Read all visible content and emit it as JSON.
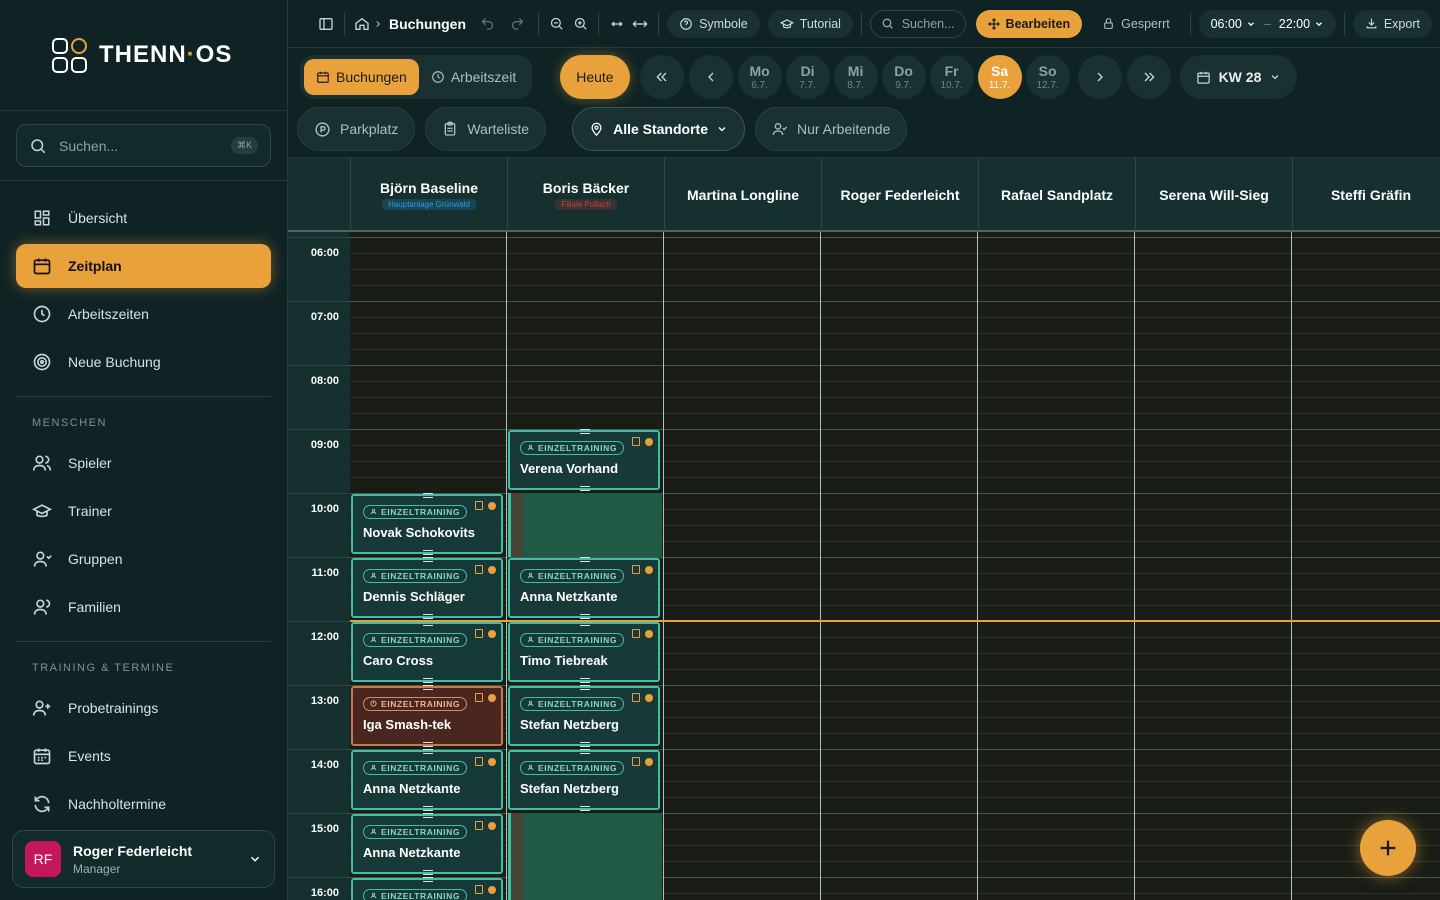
{
  "app": {
    "logo_main": "THENN",
    "logo_dot": "·",
    "logo_suffix": "OS"
  },
  "sidebar": {
    "search": {
      "placeholder": "Suchen...",
      "shortcut": "⌘K"
    },
    "items": [
      {
        "label": "Übersicht",
        "icon": "grid-icon"
      },
      {
        "label": "Zeitplan",
        "icon": "calendar-icon",
        "active": true
      },
      {
        "label": "Arbeitszeiten",
        "icon": "clock-icon"
      },
      {
        "label": "Neue Buchung",
        "icon": "target-icon"
      }
    ],
    "section_people": "MENSCHEN",
    "people_items": [
      {
        "label": "Spieler",
        "icon": "users-icon"
      },
      {
        "label": "Trainer",
        "icon": "graduation-cap-icon"
      },
      {
        "label": "Gruppen",
        "icon": "group-icon"
      },
      {
        "label": "Familien",
        "icon": "family-icon"
      }
    ],
    "section_training": "TRAINING & TERMINE",
    "training_items": [
      {
        "label": "Probetrainings",
        "icon": "user-plus-icon"
      },
      {
        "label": "Events",
        "icon": "calendar-grid-icon"
      },
      {
        "label": "Nachholtermine",
        "icon": "refresh-icon"
      }
    ],
    "user": {
      "initials": "RF",
      "name": "Roger Federleicht",
      "role": "Manager"
    }
  },
  "topbar": {
    "breadcrumb": "Buchungen",
    "symbols": "Symbole",
    "tutorial": "Tutorial",
    "search_placeholder": "Suchen...",
    "edit": "Bearbeiten",
    "locked": "Gesperrt",
    "time_from": "06:00",
    "time_sep": "–",
    "time_to": "22:00",
    "export": "Export"
  },
  "toolbar": {
    "tab_bookings": "Buchungen",
    "tab_worktime": "Arbeitszeit",
    "today": "Heute",
    "days": [
      {
        "name": "Mo",
        "date": "6.7."
      },
      {
        "name": "Di",
        "date": "7.7."
      },
      {
        "name": "Mi",
        "date": "8.7."
      },
      {
        "name": "Do",
        "date": "9.7."
      },
      {
        "name": "Fr",
        "date": "10.7."
      },
      {
        "name": "Sa",
        "date": "11.7.",
        "active": true
      },
      {
        "name": "So",
        "date": "12.7."
      }
    ],
    "week": "KW 28",
    "parking": "Parkplatz",
    "waitlist": "Warteliste",
    "locations": "Alle Standorte",
    "only_working": "Nur Arbeitende"
  },
  "calendar": {
    "trainers": [
      {
        "name": "Björn Baseline",
        "badge": "Hauptanlage Grünwald",
        "badge_color": "#2d9be0"
      },
      {
        "name": "Boris Bäcker",
        "badge": "Filiale Pullach",
        "badge_color": "#c94040"
      },
      {
        "name": "Martina Longline"
      },
      {
        "name": "Roger Federleicht"
      },
      {
        "name": "Rafael Sandplatz"
      },
      {
        "name": "Serena Will-Sieg"
      },
      {
        "name": "Steffi Gräfin"
      }
    ],
    "hours": [
      "06:00",
      "07:00",
      "08:00",
      "09:00",
      "10:00",
      "11:00",
      "12:00",
      "13:00",
      "14:00",
      "15:00",
      "16:00"
    ],
    "tag_label": "EINZELTRAINING",
    "events": [
      {
        "col": 1,
        "start": 9,
        "name": "Verena Vorhand"
      },
      {
        "col": 0,
        "start": 10,
        "name": "Novak Schokovits"
      },
      {
        "col": 0,
        "start": 11,
        "name": "Dennis Schläger"
      },
      {
        "col": 1,
        "start": 11,
        "name": "Anna Netzkante"
      },
      {
        "col": 0,
        "start": 12,
        "name": "Caro Cross"
      },
      {
        "col": 1,
        "start": 12,
        "name": "Timo Tiebreak"
      },
      {
        "col": 0,
        "start": 13,
        "name": "Iga Smash-tek",
        "warn": true
      },
      {
        "col": 1,
        "start": 13,
        "name": "Stefan Netzberg"
      },
      {
        "col": 0,
        "start": 14,
        "name": "Anna Netzkante"
      },
      {
        "col": 1,
        "start": 14,
        "name": "Stefan Netzberg"
      },
      {
        "col": 0,
        "start": 15,
        "name": "Anna Netzkante"
      },
      {
        "col": 0,
        "start": 16,
        "name": ""
      }
    ],
    "free_blocks": [
      {
        "col": 1,
        "start": 10,
        "hours": 1
      },
      {
        "col": 1,
        "start": 15,
        "hours": 2
      }
    ],
    "now": "12:00"
  }
}
